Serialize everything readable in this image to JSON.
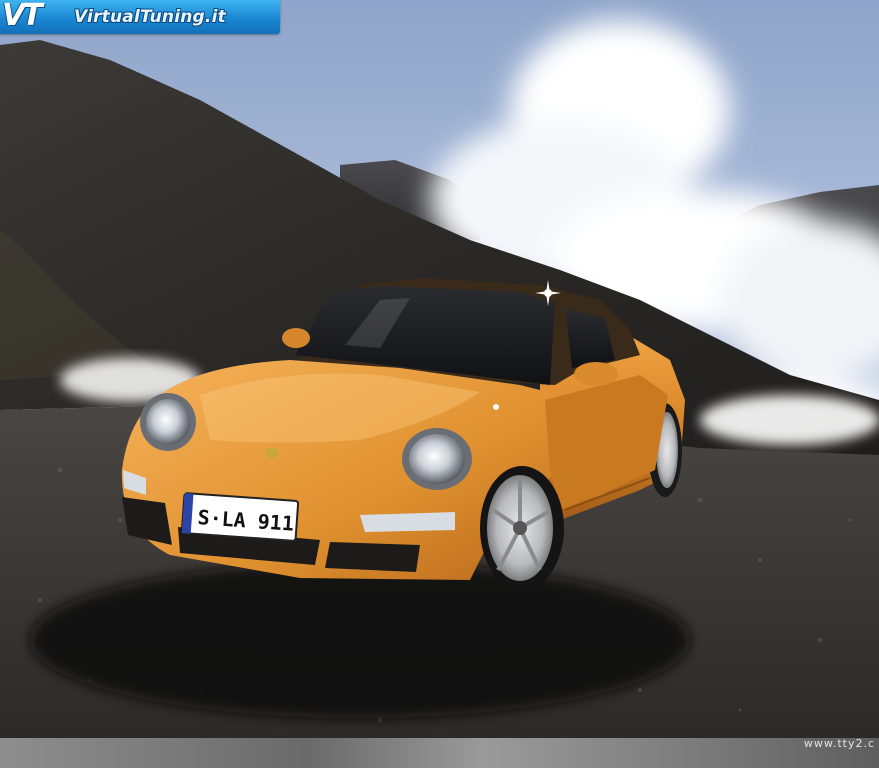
{
  "logo": {
    "mark": "VT",
    "site": "VirtualTuning.it"
  },
  "photo": {
    "subject": "Porsche 911 Targa",
    "license_plate": "S·LA 911"
  },
  "footer": {
    "credit": "www.tty2.c"
  },
  "colors": {
    "sky": "#aebfdc",
    "car_body": "#d98a2a",
    "ground": "#3a3734",
    "logo_blue": "#1b86d3"
  }
}
